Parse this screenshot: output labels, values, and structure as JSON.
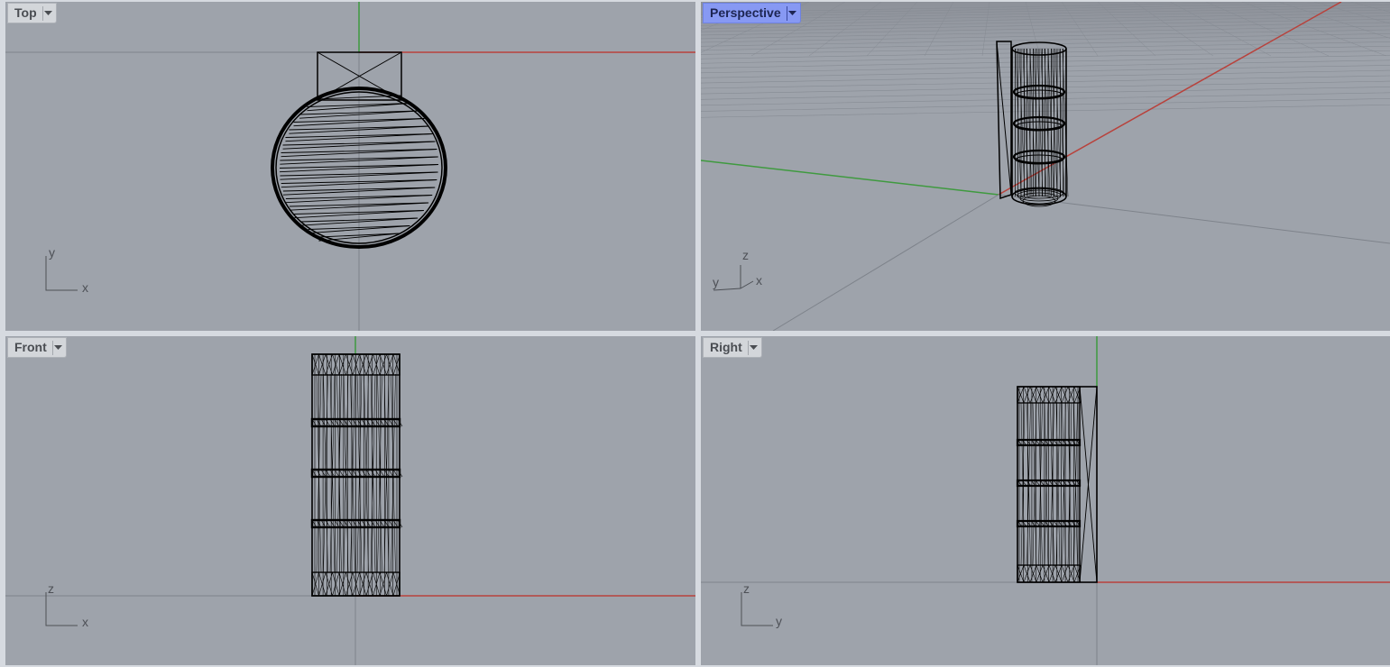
{
  "viewports": {
    "top": {
      "title": "Top",
      "axis_labels": {
        "horizontal": "x",
        "vertical": "y"
      }
    },
    "perspective": {
      "title": "Perspective",
      "active": true,
      "axis_labels": {
        "up": "z",
        "left": "y",
        "right": "x"
      }
    },
    "front": {
      "title": "Front",
      "axis_labels": {
        "horizontal": "x",
        "vertical": "z"
      }
    },
    "right": {
      "title": "Right",
      "axis_labels": {
        "horizontal": "y",
        "vertical": "z"
      }
    }
  },
  "colors": {
    "viewport_bg": "#9ea3ab",
    "x_axis": "#b8423c",
    "y_axis": "#3f9a3f",
    "grid": "#7e838b",
    "active_tab": "#8799f3",
    "wire": "#000000"
  },
  "icons": {
    "viewport_menu": "chevron-down-icon"
  }
}
